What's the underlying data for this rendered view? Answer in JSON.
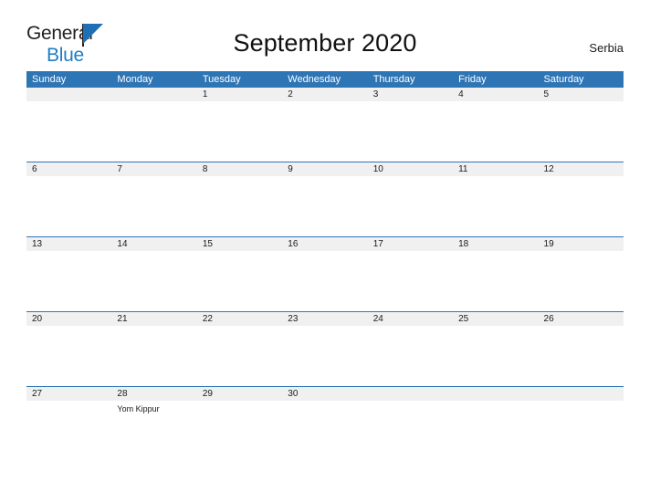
{
  "brand": {
    "name_part1": "General",
    "name_part2": "Blue",
    "flag_color": "#1f6fb5",
    "text_color_part1": "#231f20",
    "text_color_part2": "#1f7cc4"
  },
  "header": {
    "title": "September 2020",
    "region": "Serbia"
  },
  "calendar": {
    "accent_color": "#2e75b6",
    "strip_color": "#f0f0f0",
    "weekdays": [
      "Sunday",
      "Monday",
      "Tuesday",
      "Wednesday",
      "Thursday",
      "Friday",
      "Saturday"
    ],
    "weeks": [
      [
        {
          "day": "",
          "events": []
        },
        {
          "day": "",
          "events": []
        },
        {
          "day": "1",
          "events": []
        },
        {
          "day": "2",
          "events": []
        },
        {
          "day": "3",
          "events": []
        },
        {
          "day": "4",
          "events": []
        },
        {
          "day": "5",
          "events": []
        }
      ],
      [
        {
          "day": "6",
          "events": []
        },
        {
          "day": "7",
          "events": []
        },
        {
          "day": "8",
          "events": []
        },
        {
          "day": "9",
          "events": []
        },
        {
          "day": "10",
          "events": []
        },
        {
          "day": "11",
          "events": []
        },
        {
          "day": "12",
          "events": []
        }
      ],
      [
        {
          "day": "13",
          "events": []
        },
        {
          "day": "14",
          "events": []
        },
        {
          "day": "15",
          "events": []
        },
        {
          "day": "16",
          "events": []
        },
        {
          "day": "17",
          "events": []
        },
        {
          "day": "18",
          "events": []
        },
        {
          "day": "19",
          "events": []
        }
      ],
      [
        {
          "day": "20",
          "events": []
        },
        {
          "day": "21",
          "events": []
        },
        {
          "day": "22",
          "events": []
        },
        {
          "day": "23",
          "events": []
        },
        {
          "day": "24",
          "events": []
        },
        {
          "day": "25",
          "events": []
        },
        {
          "day": "26",
          "events": []
        }
      ],
      [
        {
          "day": "27",
          "events": []
        },
        {
          "day": "28",
          "events": [
            "Yom Kippur"
          ]
        },
        {
          "day": "29",
          "events": []
        },
        {
          "day": "30",
          "events": []
        },
        {
          "day": "",
          "events": []
        },
        {
          "day": "",
          "events": []
        },
        {
          "day": "",
          "events": []
        }
      ]
    ]
  }
}
